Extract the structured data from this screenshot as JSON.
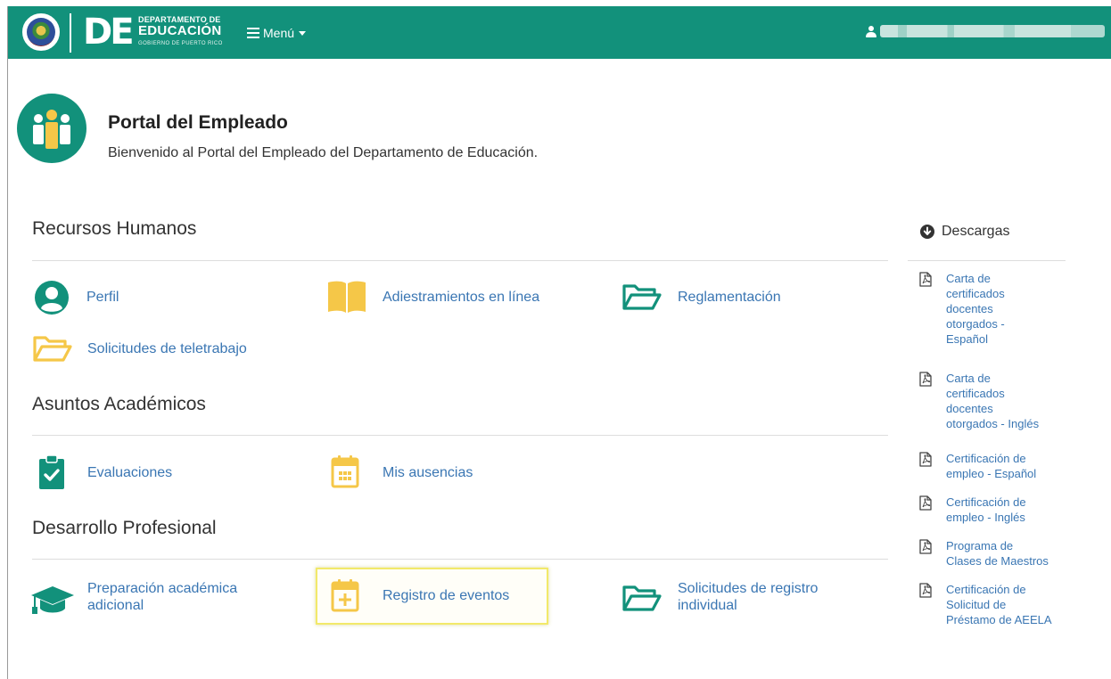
{
  "navbar": {
    "logo_mark": "DE",
    "logo_line1": "DEPARTAMENTO DE",
    "logo_line2": "EDUCACIÓN",
    "logo_line3": "GOBIERNO DE PUERTO RICO",
    "menu_label": "Menú",
    "user_name": "",
    "colors": {
      "brand": "#12917b"
    }
  },
  "header": {
    "title": "Portal del Empleado",
    "subtitle": "Bienvenido al Portal del Empleado del Departamento de Educación."
  },
  "sections": {
    "rrhh": {
      "title": "Recursos Humanos",
      "items": [
        {
          "label": "Perfil",
          "icon": "user-circle-icon"
        },
        {
          "label": "Adiestramientos en línea",
          "icon": "book-open-icon"
        },
        {
          "label": "Reglamentación",
          "icon": "folder-open-icon"
        },
        {
          "label": "Solicitudes de teletrabajo",
          "icon": "folder-open-icon"
        }
      ]
    },
    "academicos": {
      "title": "Asuntos Académicos",
      "items": [
        {
          "label": "Evaluaciones",
          "icon": "clipboard-check-icon"
        },
        {
          "label": "Mis ausencias",
          "icon": "calendar-icon"
        }
      ]
    },
    "profesional": {
      "title": "Desarrollo Profesional",
      "items": [
        {
          "label_line1": "Preparación académica",
          "label_line2": "adicional",
          "icon": "graduation-cap-icon"
        },
        {
          "label": "Registro de eventos",
          "icon": "calendar-plus-icon"
        },
        {
          "label_line1": "Solicitudes de registro",
          "label_line2": "individual",
          "icon": "folder-open-icon"
        }
      ]
    }
  },
  "downloads": {
    "title": "Descargas",
    "items": [
      {
        "lines": [
          "Carta de",
          "certificados",
          "docentes",
          "otorgados -",
          "Español"
        ]
      },
      {
        "lines": [
          "Carta de",
          "certificados",
          "docentes",
          "otorgados - Inglés"
        ]
      },
      {
        "lines": [
          "Certificación de",
          "empleo - Español"
        ]
      },
      {
        "lines": [
          "Certificación de",
          "empleo - Inglés"
        ]
      },
      {
        "lines": [
          "Programa de",
          "Clases de Maestros"
        ]
      },
      {
        "lines": [
          "Certificación de",
          "Solicitud de",
          "Préstamo de AEELA"
        ]
      }
    ]
  },
  "colors": {
    "link": "#3a76b3",
    "accent_yellow": "#f5c748",
    "teal": "#12917b",
    "highlight_border": "#f2e96a"
  }
}
